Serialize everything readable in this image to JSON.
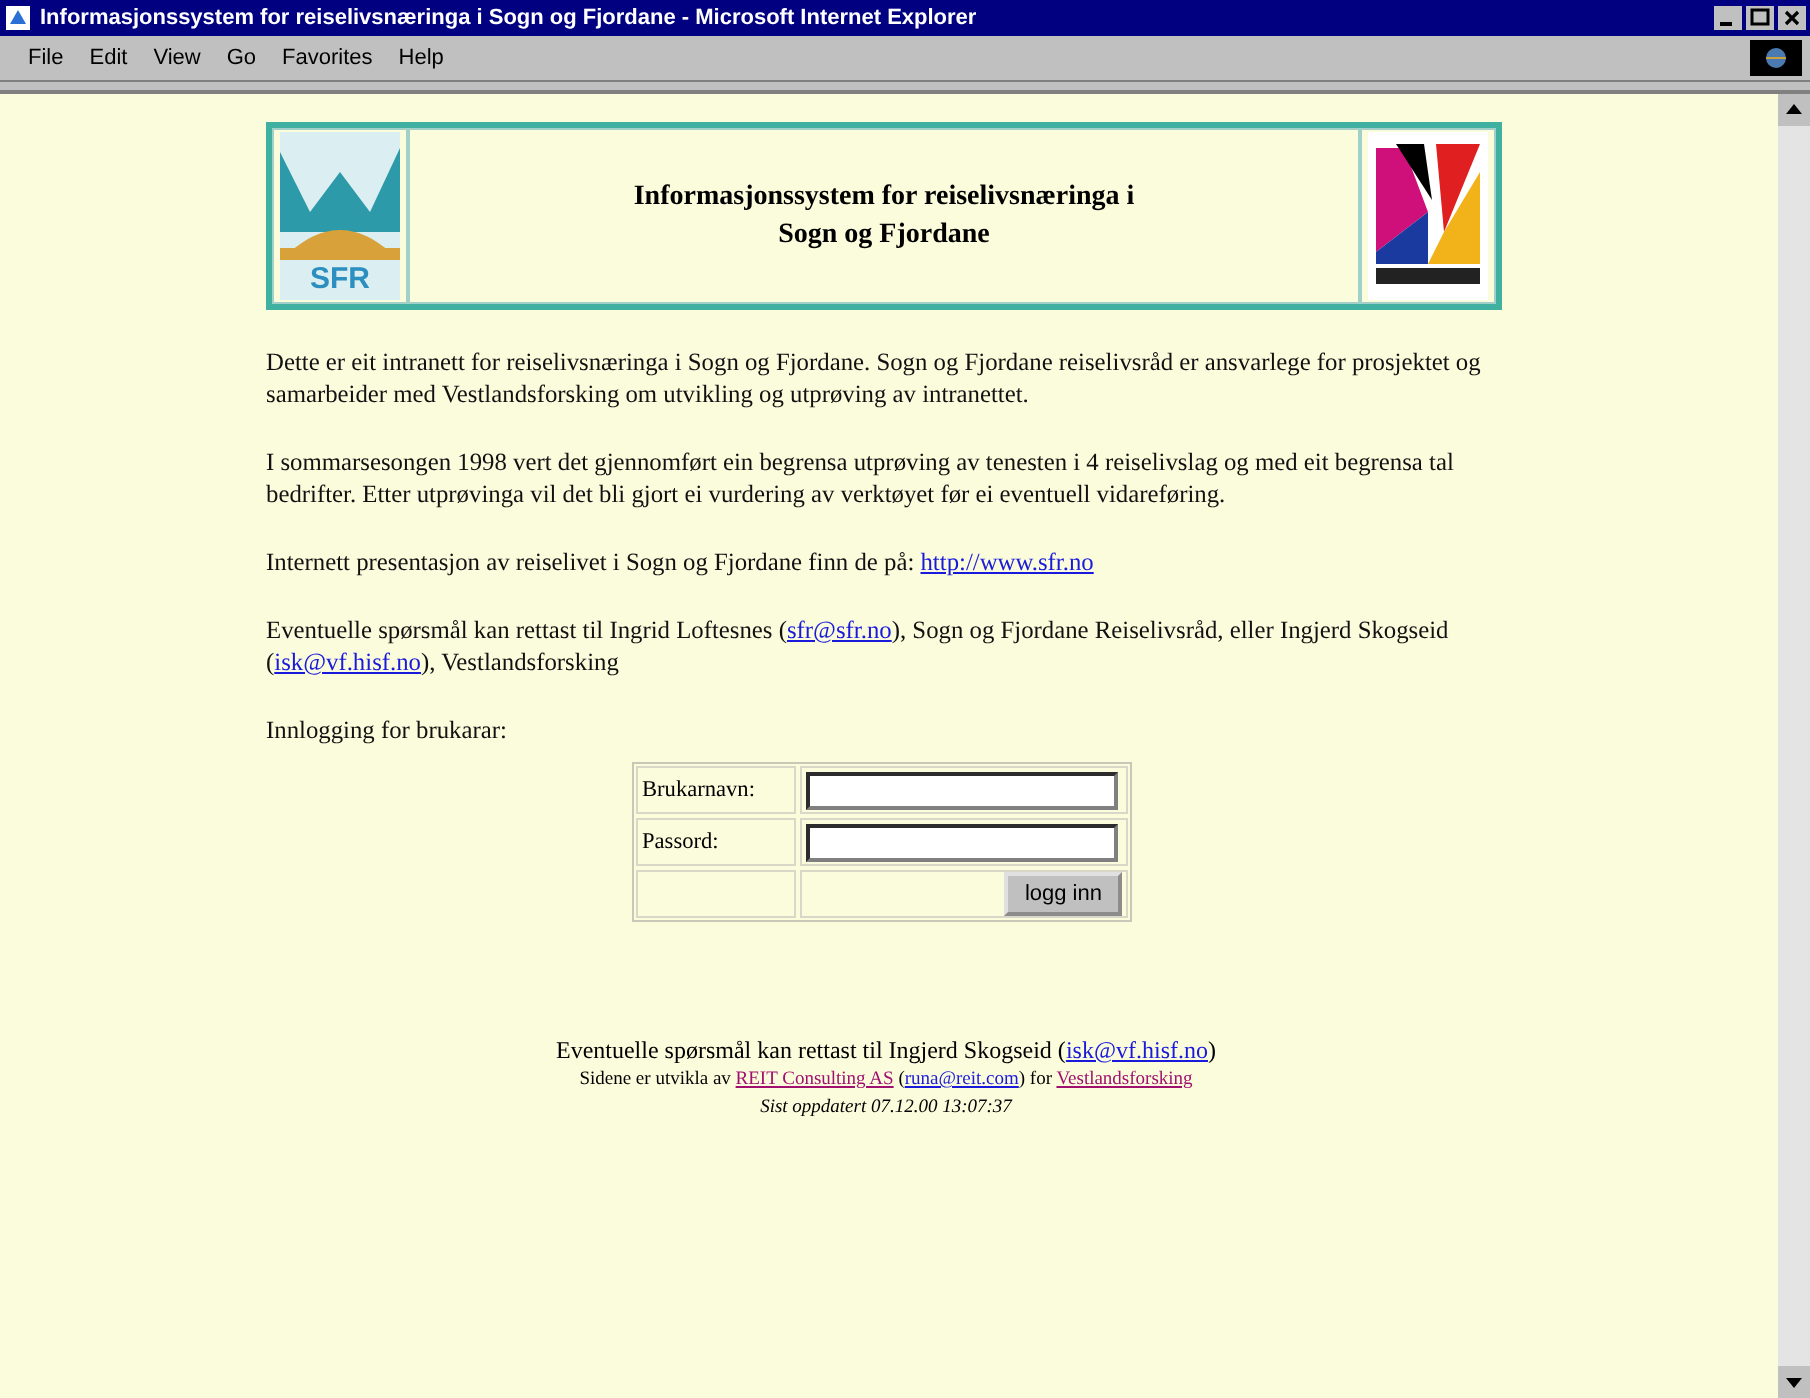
{
  "window": {
    "title": "Informasjonssystem for reiselivsnæringa i Sogn og Fjordane - Microsoft Internet Explorer"
  },
  "menu": [
    "File",
    "Edit",
    "View",
    "Go",
    "Favorites",
    "Help"
  ],
  "header": {
    "title_lines": [
      "Informasjonssystem for reiselivsnæringa i",
      "Sogn og Fjordane"
    ],
    "left_logo_text": "SFR"
  },
  "paragraphs": [
    [
      {
        "kind": "text",
        "text": "Dette er eit intranett for reiselivsnæringa i Sogn og Fjordane. Sogn og Fjordane reiselivsråd er ansvarlege for prosjektet og samarbeider med Vestlandsforsking om utvikling og utprøving av intranettet."
      }
    ],
    [
      {
        "kind": "text",
        "text": "I sommarsesongen 1998 vert det gjennomført ein begrensa utprøving av tenesten i 4 reiselivslag og med eit begrensa tal bedrifter. Etter utprøvinga vil det bli gjort ei vurdering av verktøyet før ei eventuell vidareføring."
      }
    ],
    [
      {
        "kind": "text",
        "text": "Internett presentasjon av reiselivet i Sogn og Fjordane finn de på: "
      },
      {
        "kind": "link",
        "text": "http://www.sfr.no",
        "visited": false
      }
    ],
    [
      {
        "kind": "text",
        "text": "Eventuelle spørsmål kan rettast til Ingrid Loftesnes ("
      },
      {
        "kind": "link",
        "text": "sfr@sfr.no",
        "visited": false
      },
      {
        "kind": "text",
        "text": "), Sogn og Fjordane Reiselivsråd, eller Ingjerd Skogseid ("
      },
      {
        "kind": "link",
        "text": "isk@vf.hisf.no",
        "visited": false
      },
      {
        "kind": "text",
        "text": "), Vestlandsforsking"
      }
    ],
    [
      {
        "kind": "text",
        "text": "Innlogging for brukarar:"
      }
    ]
  ],
  "login": {
    "fields": [
      {
        "label": "Brukarnavn:"
      },
      {
        "label": "Passord:"
      }
    ],
    "button": "logg inn"
  },
  "footer": [
    {
      "parts": [
        {
          "kind": "text",
          "text": "Eventuelle spørsmål kan rettast til Ingjerd Skogseid ("
        },
        {
          "kind": "link",
          "text": "isk@vf.hisf.no",
          "visited": false
        },
        {
          "kind": "text",
          "text": ")"
        }
      ]
    },
    {
      "parts": [
        {
          "kind": "text",
          "text": "Sidene er utvikla av "
        },
        {
          "kind": "link",
          "text": "REIT Consulting AS",
          "visited": true
        },
        {
          "kind": "text",
          "text": " ("
        },
        {
          "kind": "link",
          "text": "runa@reit.com",
          "visited": false
        },
        {
          "kind": "text",
          "text": ") for "
        },
        {
          "kind": "link",
          "text": "Vestlandsforsking",
          "visited": true
        }
      ]
    },
    {
      "parts": [
        {
          "kind": "text",
          "text": "Sist oppdatert 07.12.00 13:07:37"
        }
      ]
    }
  ]
}
